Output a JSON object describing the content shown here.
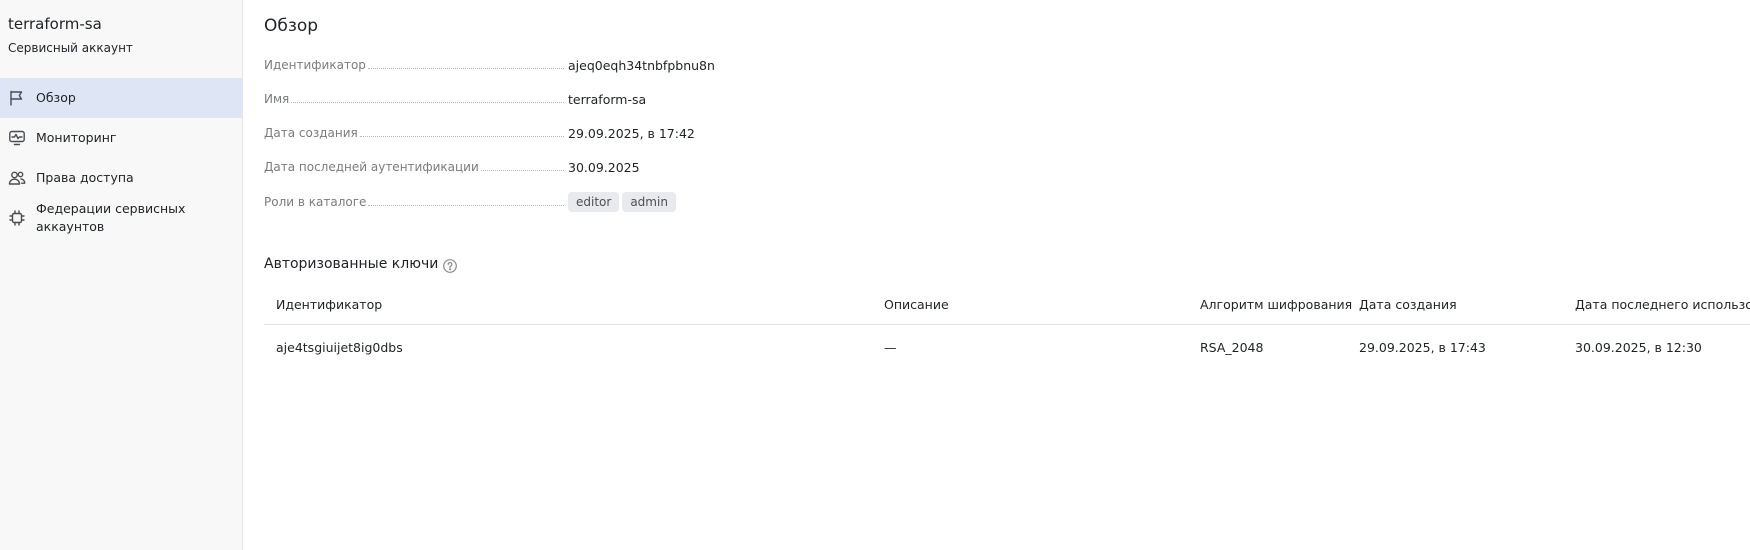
{
  "sidebar": {
    "title": "terraform-sa",
    "subtitle": "Сервисный аккаунт",
    "items": [
      {
        "label": "Обзор",
        "icon": "flag-icon",
        "active": true
      },
      {
        "label": "Мониторинг",
        "icon": "monitor-icon",
        "active": false
      },
      {
        "label": "Права доступа",
        "icon": "users-icon",
        "active": false
      },
      {
        "label": "Федерации сервисных аккаунтов",
        "icon": "chip-icon",
        "active": false
      }
    ]
  },
  "main": {
    "title": "Обзор",
    "properties": [
      {
        "label": "Идентификатор",
        "value": "ajeq0eqh34tnbfpbnu8n"
      },
      {
        "label": "Имя",
        "value": "terraform-sa"
      },
      {
        "label": "Дата создания",
        "value": "29.09.2025, в 17:42"
      },
      {
        "label": "Дата последней аутентификации",
        "value": "30.09.2025"
      },
      {
        "label": "Роли в каталоге",
        "tags": [
          "editor",
          "admin"
        ]
      }
    ],
    "keys_section": {
      "title": "Авторизованные ключи",
      "help_icon": "question-circle-icon",
      "columns": [
        "Идентификатор",
        "Описание",
        "Алгоритм шифрования",
        "Дата создания",
        "Дата последнего использова"
      ],
      "rows": [
        [
          "aje4tsgiuijet8ig0dbs",
          "—",
          "RSA_2048",
          "29.09.2025, в 17:43",
          "30.09.2025, в 12:30"
        ]
      ]
    }
  },
  "colors": {
    "active_nav_bg": "#dee5f5",
    "sidebar_bg": "#f8f8f8",
    "tag_bg": "#e8eaed",
    "label_text": "#7a7c80"
  }
}
